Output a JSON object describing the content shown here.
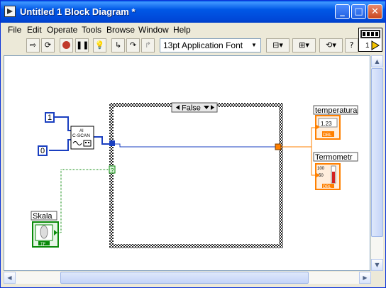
{
  "window": {
    "title": "Untitled 1 Block Diagram *"
  },
  "menu": [
    {
      "label": "File"
    },
    {
      "label": "Edit"
    },
    {
      "label": "Operate"
    },
    {
      "label": "Tools"
    },
    {
      "label": "Browse"
    },
    {
      "label": "Window"
    },
    {
      "label": "Help"
    }
  ],
  "toolbar": {
    "font": "13pt Application Font",
    "vi_number": "1"
  },
  "diagram": {
    "const_top": "1",
    "const_bottom": "0",
    "subvi_label_top": "AI",
    "subvi_label_bottom": "C-SCAN",
    "case_selector": "False",
    "indicator1_label": "temperatura",
    "indicator1_value": "1.23",
    "indicator1_type": "DBL",
    "indicator2_label": "Termometr",
    "indicator2_scale_top": "100",
    "indicator2_scale_mid": "50",
    "indicator2_type": "DBL",
    "control_label": "Skala",
    "control_type": "TF",
    "tunnel_marker": "?"
  },
  "colors": {
    "title_bar": "#0054e3",
    "wire_numeric": "#1a3fc0",
    "wire_orange": "#ff8000",
    "wire_bool": "#0a8a0a"
  }
}
